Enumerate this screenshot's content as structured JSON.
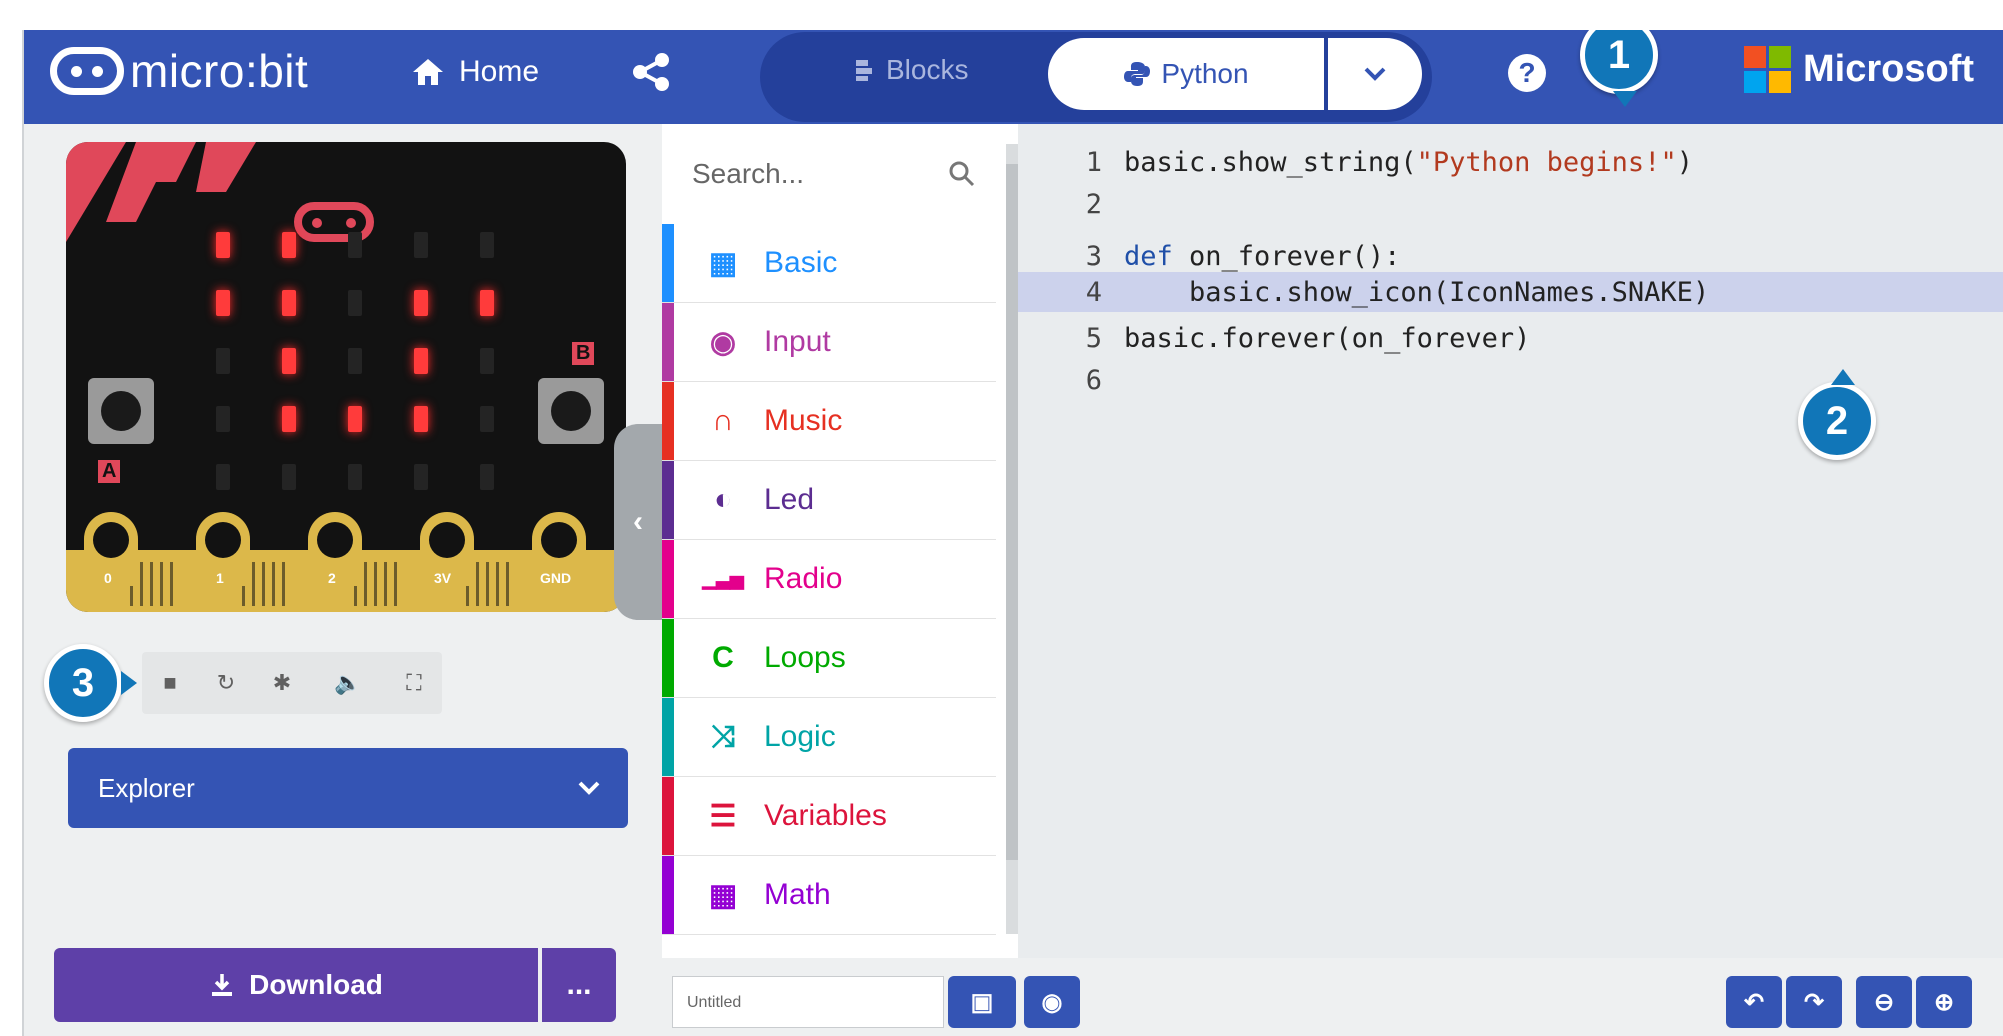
{
  "header": {
    "logo_text": "micro:bit",
    "home_label": "Home",
    "tab_blocks_label": "Blocks",
    "tab_python_label": "Python",
    "help_label": "?",
    "microsoft_label": "Microsoft"
  },
  "simulator": {
    "button_a_label": "A",
    "button_b_label": "B",
    "pins": [
      "0",
      "1",
      "2",
      "3V",
      "GND"
    ],
    "led_matrix": [
      [
        1,
        1,
        0,
        0,
        0
      ],
      [
        1,
        1,
        0,
        1,
        1
      ],
      [
        0,
        1,
        0,
        1,
        0
      ],
      [
        0,
        1,
        1,
        1,
        0
      ],
      [
        0,
        0,
        0,
        0,
        0
      ]
    ],
    "tools": [
      "stop-icon",
      "restart-icon",
      "debug-icon",
      "sound-icon",
      "fullscreen-icon"
    ]
  },
  "sidebar": {
    "explorer_label": "Explorer",
    "download_label": "Download",
    "more_label": "..."
  },
  "toolbox": {
    "search_placeholder": "Search...",
    "categories": [
      {
        "label": "Basic",
        "color": "#1e90ff",
        "icon": "grid-icon"
      },
      {
        "label": "Input",
        "color": "#b03aa2",
        "icon": "target-icon"
      },
      {
        "label": "Music",
        "color": "#e63022",
        "icon": "headphones-icon"
      },
      {
        "label": "Led",
        "color": "#5c2d91",
        "icon": "toggle-icon"
      },
      {
        "label": "Radio",
        "color": "#e3008c",
        "icon": "signal-icon"
      },
      {
        "label": "Loops",
        "color": "#00aa00",
        "icon": "loop-icon"
      },
      {
        "label": "Logic",
        "color": "#00a4a6",
        "icon": "shuffle-icon"
      },
      {
        "label": "Variables",
        "color": "#dc143c",
        "icon": "lines-icon"
      },
      {
        "label": "Math",
        "color": "#9400d3",
        "icon": "calculator-icon"
      }
    ]
  },
  "editor": {
    "lines": [
      {
        "num": "1",
        "text": "basic.show_string(\"Python begins!\")"
      },
      {
        "num": "2",
        "text": ""
      },
      {
        "num": "3",
        "text": "def on_forever():"
      },
      {
        "num": "4",
        "text": "    basic.show_icon(IconNames.SNAKE)"
      },
      {
        "num": "5",
        "text": "basic.forever(on_forever)"
      },
      {
        "num": "6",
        "text": ""
      }
    ],
    "line1_prefix": "basic.show_string(",
    "line1_string": "\"Python begins!\"",
    "line1_suffix": ")",
    "line3_keyword": "def",
    "line3_rest": " on_forever():",
    "line4_text": "    basic.show_icon(IconNames.SNAKE)",
    "line5_text": "basic.forever(on_forever)"
  },
  "footer": {
    "project_name": "Untitled"
  },
  "callouts": [
    "1",
    "2",
    "3"
  ]
}
